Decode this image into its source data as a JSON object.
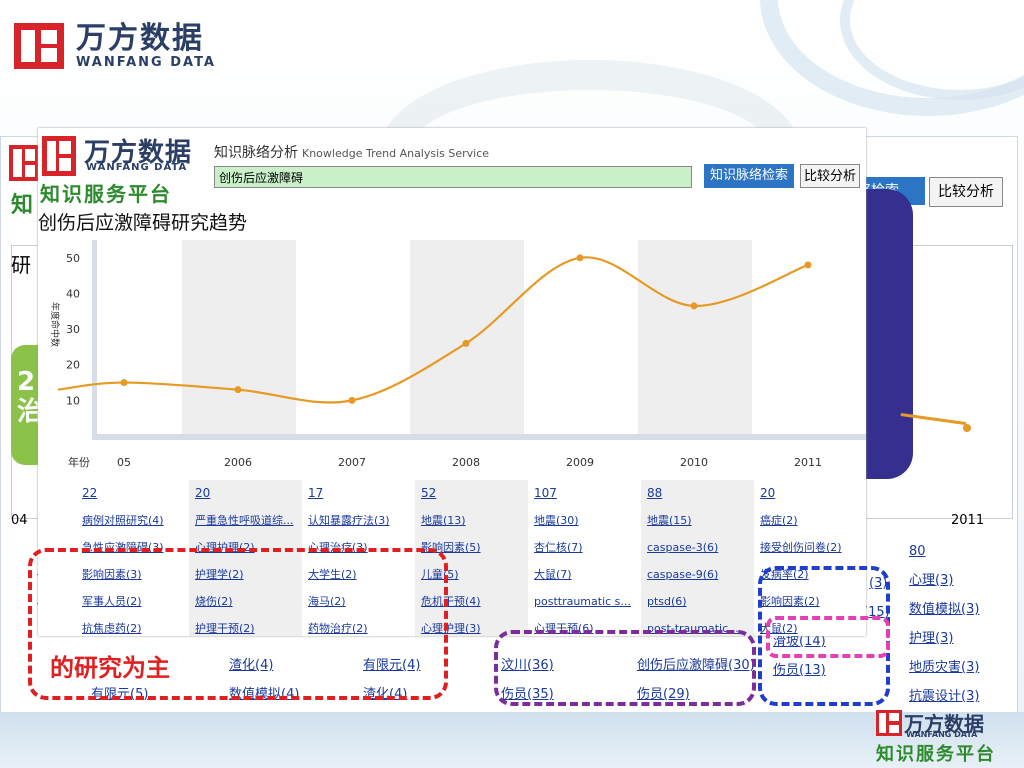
{
  "slide": {
    "top_logo_cn": "万方数据",
    "top_logo_en": "WANFANG DATA",
    "red_callout_text": "的研究为主",
    "bottom_logo_cn": "万方数据",
    "bottom_logo_en": "WANFANG DATA",
    "bottom_platform": "知识服务平台"
  },
  "bg_screenshot": {
    "logo_cn": "知",
    "search_button": "络检索",
    "compare_button": "比较分析",
    "title_fragment": "研",
    "green_text": "2\n治",
    "axis_start": "04",
    "axis_end": "2011",
    "col_2011_count": "80",
    "col_2011_items": [
      "心理(3)",
      "数值模拟(3)",
      "护理(3)",
      "地质灾害(3)",
      "抗震设计(3)"
    ],
    "col_blue_items": [
      "(3)",
      "(15)",
      "滑坡(14)",
      "伤员(13)"
    ],
    "col_purple_left": [
      "汶川(36)",
      "伤员(35)"
    ],
    "col_purple_right": [
      "创伤后应激障碍(30)",
      "伤员(29)"
    ],
    "col_red_items": [
      "渣化(4)",
      "数值模拟(4)"
    ],
    "col_red_items2": [
      "有限元(4)",
      "渣化(4)"
    ],
    "col_red_items3": [
      "有限元(5)"
    ],
    "left_edge_items": [
      "2)",
      "2)"
    ]
  },
  "main": {
    "logo_cn": "万方数据",
    "logo_en": "WANFANG DATA",
    "platform": "知识服务平台",
    "service_cn": "知识脉络分析",
    "service_en": "Knowledge Trend Analysis Service",
    "search_value": "创伤后应激障碍",
    "search_button": "知识脉络检索",
    "compare_button": "比较分析",
    "chart_title": "创伤后应激障碍研究趋势"
  },
  "chart_data": {
    "type": "line",
    "title": "创伤后应激障碍研究趋势",
    "xlabel": "年份",
    "ylabel": "年度命中数",
    "x": [
      "04",
      "05",
      "2006",
      "2007",
      "2008",
      "2009",
      "2010",
      "2011"
    ],
    "tick_labels": [
      "05",
      "2006",
      "2007",
      "2008",
      "2009",
      "2010",
      "2011"
    ],
    "series": [
      {
        "values": [
          13,
          15,
          13,
          10,
          26,
          50,
          36.5,
          48
        ]
      }
    ],
    "yticks": [
      10,
      20,
      30,
      40,
      50
    ],
    "ylim": [
      0,
      55
    ],
    "color": "#e69a23"
  },
  "table": {
    "columns": [
      {
        "count": "22",
        "items": [
          "病例对照研究(4)",
          "急性应激障碍(3)",
          "影响因素(3)",
          "军事人员(2)",
          "抗焦虑药(2)"
        ]
      },
      {
        "count": "20",
        "items": [
          "严重急性呼吸道综...",
          "心理护理(2)",
          "护理学(2)",
          "烧伤(2)",
          "护理干预(2)"
        ]
      },
      {
        "count": "17",
        "items": [
          "认知暴露疗法(3)",
          "心理治疗(3)",
          "大学生(2)",
          "海马(2)",
          "药物治疗(2)"
        ]
      },
      {
        "count": "52",
        "items": [
          "地震(13)",
          "影响因素(5)",
          "儿童(5)",
          "危机干预(4)",
          "心理护理(3)"
        ]
      },
      {
        "count": "107",
        "items": [
          "地震(30)",
          "杏仁核(7)",
          "大鼠(7)",
          "posttraumatic s...",
          "心理干预(6)"
        ]
      },
      {
        "count": "88",
        "items": [
          "地震(15)",
          "caspase-3(6)",
          "caspase-9(6)",
          "ptsd(6)",
          "post-traumatic ..."
        ]
      },
      {
        "count": "20",
        "items": [
          "癌症(2)",
          "接受创伤问卷(2)",
          "发病率(2)",
          "影响因素(2)",
          "大鼠(2)"
        ]
      }
    ]
  }
}
